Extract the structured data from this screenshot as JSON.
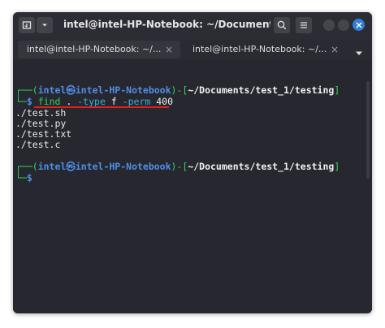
{
  "window": {
    "title": "intel@intel-HP-Notebook: ~/Documents/tes..."
  },
  "tabs": [
    {
      "label": "intel@intel-HP-Notebook: ~/...",
      "close": "×",
      "active": true
    },
    {
      "label": "intel@intel-HP-Notebook: ~/...",
      "close": "×",
      "active": false
    }
  ],
  "terminal": {
    "prompt1": {
      "corner": "┌──(",
      "user": "intel",
      "at": "㉿",
      "host": "intel-HP-Notebook",
      "mid": ")-[",
      "path": "~/Documents/test_1/testing",
      "end": "]",
      "corner2": "└─",
      "dollar": "$"
    },
    "command": {
      "cmd": "find",
      "arg1": ".",
      "flag1": "-type",
      "val1": "f",
      "flag2": "-perm",
      "val2": "400"
    },
    "output": [
      "./test.sh",
      "./test.py",
      "./test.txt",
      "./test.c"
    ],
    "prompt2": {
      "corner": "┌──(",
      "user": "intel",
      "at": "㉿",
      "host": "intel-HP-Notebook",
      "mid": ")-[",
      "path": "~/Documents/test_1/testing",
      "end": "]",
      "corner2": "└─",
      "dollar": "$"
    }
  },
  "colors": {
    "prompt_green": "#2fd35d",
    "prompt_blue": "#4f8fe6",
    "accent_close": "#2f7fd8",
    "annotation_red": "#e02020"
  }
}
